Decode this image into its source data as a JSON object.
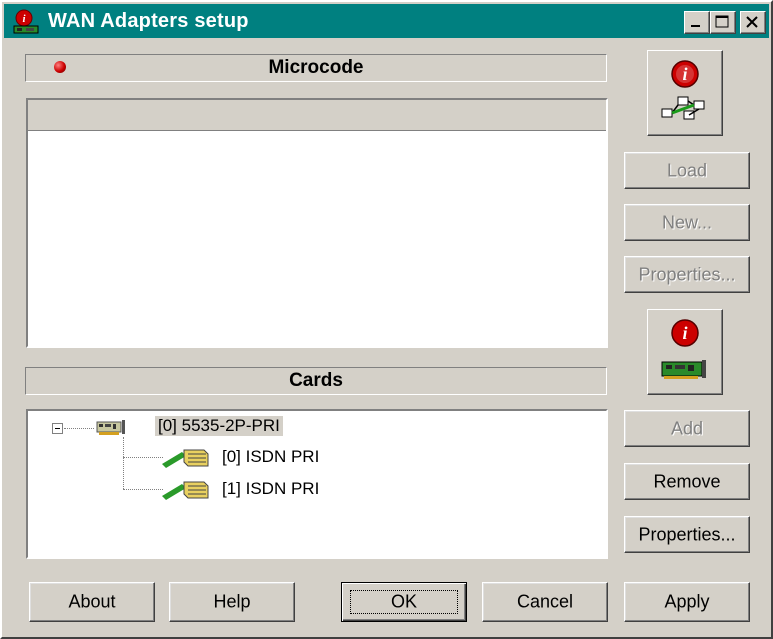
{
  "window": {
    "title": "WAN Adapters setup"
  },
  "title_buttons": {
    "minimize": "_",
    "maximize": "□",
    "close": "✕"
  },
  "microcode": {
    "header": "Microcode",
    "buttons": {
      "load": "Load",
      "new": "New...",
      "properties": "Properties..."
    }
  },
  "cards": {
    "header": "Cards",
    "tree": {
      "root": "[0] 5535-2P-PRI",
      "children": [
        "[0] ISDN PRI",
        "[1] ISDN PRI"
      ]
    },
    "buttons": {
      "add": "Add",
      "remove": "Remove",
      "properties": "Properties..."
    }
  },
  "footer": {
    "about": "About",
    "help": "Help",
    "ok": "OK",
    "cancel": "Cancel",
    "apply": "Apply"
  },
  "colors": {
    "titlebar": "#008080",
    "face": "#d4d0c8",
    "led": "#cc0000"
  },
  "icons": [
    "wan-adapter-icon",
    "network-info-icon",
    "card-info-icon",
    "adapter-card-icon",
    "isdn-port-icon"
  ]
}
